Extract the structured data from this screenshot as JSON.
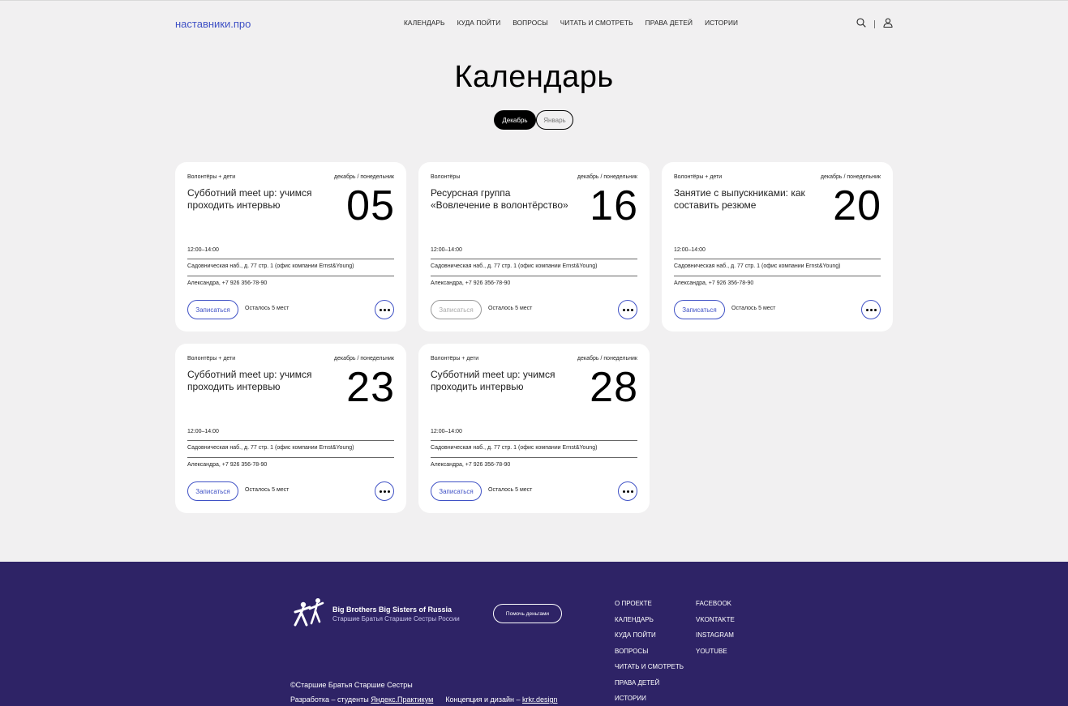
{
  "header": {
    "logo": "наставники.про",
    "nav": [
      "КАЛЕНДАРЬ",
      "КУДА ПОЙТИ",
      "ВОПРОСЫ",
      "ЧИТАТЬ И СМОТРЕТЬ",
      "ПРАВА ДЕТЕЙ",
      "ИСТОРИИ"
    ]
  },
  "page": {
    "title": "Календарь",
    "tabs": [
      {
        "label": "Декабрь",
        "active": true
      },
      {
        "label": "Январь",
        "active": false
      }
    ]
  },
  "cards": [
    {
      "category": "Волонтёры + дети",
      "date_label": "декабрь / понедельник",
      "title": "Субботний meet up: учимся проходить интервью",
      "day": "05",
      "time": "12:00–14:00",
      "address": "Садовническая наб., д. 77 стр. 1 (офис компании Ernst&Young)",
      "contact": "Александра, +7 926 356-78-90",
      "signup": "Записаться",
      "signup_disabled": false,
      "seats": "Осталось 5 мест"
    },
    {
      "category": "Волонтёры",
      "date_label": "декабрь / понедельник",
      "title": "Ресурсная группа «Вовлечение в волонтёрство»",
      "day": "16",
      "time": "12:00–14:00",
      "address": "Садовническая наб., д. 77 стр. 1 (офис компании Ernst&Young)",
      "contact": "Александра, +7 926 356-78-90",
      "signup": "Записаться",
      "signup_disabled": true,
      "seats": "Осталось 5 мест"
    },
    {
      "category": "Волонтёры + дети",
      "date_label": "декабрь / понедельник",
      "title": "Занятие с выпускниками: как составить резюме",
      "day": "20",
      "time": "12:00–14:00",
      "address": "Садовническая наб., д. 77 стр. 1 (офис компании Ernst&Young)",
      "contact": "Александра, +7 926 356-78-90",
      "signup": "Записаться",
      "signup_disabled": false,
      "seats": "Осталось 5 мест"
    },
    {
      "category": "Волонтёры + дети",
      "date_label": "декабрь / понедельник",
      "title": "Субботний meet up: учимся проходить интервью",
      "day": "23",
      "time": "12:00–14:00",
      "address": "Садовническая наб., д. 77 стр. 1 (офис компании Ernst&Young)",
      "contact": "Александра, +7 926 356-78-90",
      "signup": "Записаться",
      "signup_disabled": false,
      "seats": "Осталось 5 мест"
    },
    {
      "category": "Волонтёры + дети",
      "date_label": "декабрь / понедельник",
      "title": "Субботний meet up: учимся проходить интервью",
      "day": "28",
      "time": "12:00–14:00",
      "address": "Садовническая наб., д. 77 стр. 1 (офис компании Ernst&Young)",
      "contact": "Александра, +7 926 356-78-90",
      "signup": "Записаться",
      "signup_disabled": false,
      "seats": "Осталось 5 мест"
    }
  ],
  "footer": {
    "brand_en": "Big Brothers Big Sisters of Russia",
    "brand_ru": "Старшие Братья Старшие Сестры России",
    "donate": "Помочь деньгами",
    "links_col1": [
      "О ПРОЕКТЕ",
      "КАЛЕНДАРЬ",
      "КУДА ПОЙТИ",
      "ВОПРОСЫ",
      "ЧИТАТЬ И СМОТРЕТЬ",
      "ПРАВА ДЕТЕЙ",
      "ИСТОРИИ"
    ],
    "links_col2": [
      "FACEBOOK",
      "VKONTAKTE",
      "INSTAGRAM",
      "YOUTUBE"
    ],
    "copyright": "©Старшие Братья Старшие Сестры",
    "dev_prefix": "Разработка – студенты",
    "dev_link": "Яндекс.Практикум",
    "design_prefix": "Концепция и дизайн –",
    "design_link": "krkr.design"
  },
  "colors": {
    "accent": "#3f51c5",
    "footer_bg": "#2e2366",
    "page_bg": "#f1f0f1"
  }
}
